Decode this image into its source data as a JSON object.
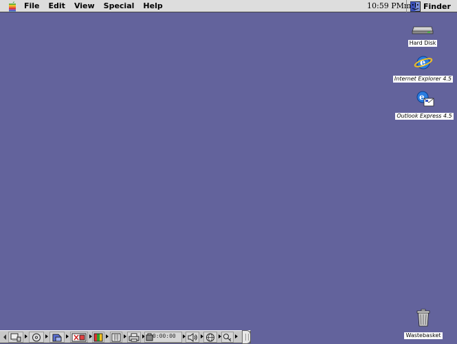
{
  "menubar": {
    "items": [
      "File",
      "Edit",
      "View",
      "Special",
      "Help"
    ],
    "clock": "10:59 PMm",
    "app_name": "Finder"
  },
  "desktop": {
    "icons": [
      {
        "name": "hard-disk",
        "label": "Hard Disk",
        "icon": "hard-disk-icon"
      },
      {
        "name": "internet-explorer",
        "label": "Internet Explorer 4.5",
        "icon": "internet-explorer-icon"
      },
      {
        "name": "outlook-express",
        "label": "Outlook Express 4.5",
        "icon": "outlook-express-icon"
      },
      {
        "name": "wastebasket",
        "label": "Wastebasket",
        "icon": "trash-icon"
      }
    ],
    "background_color": "#63639c"
  },
  "control_strip": {
    "timer": "0:00:00",
    "modules": [
      "appletalk-icon",
      "cd-player-icon",
      "file-sharing-icon",
      "location-manager-icon",
      "monitor-bitdepth-icon",
      "monitor-resolution-icon",
      "printer-icon",
      "remote-access-icon",
      "sound-volume-icon",
      "web-sharing-icon",
      "keychain-icon"
    ]
  }
}
